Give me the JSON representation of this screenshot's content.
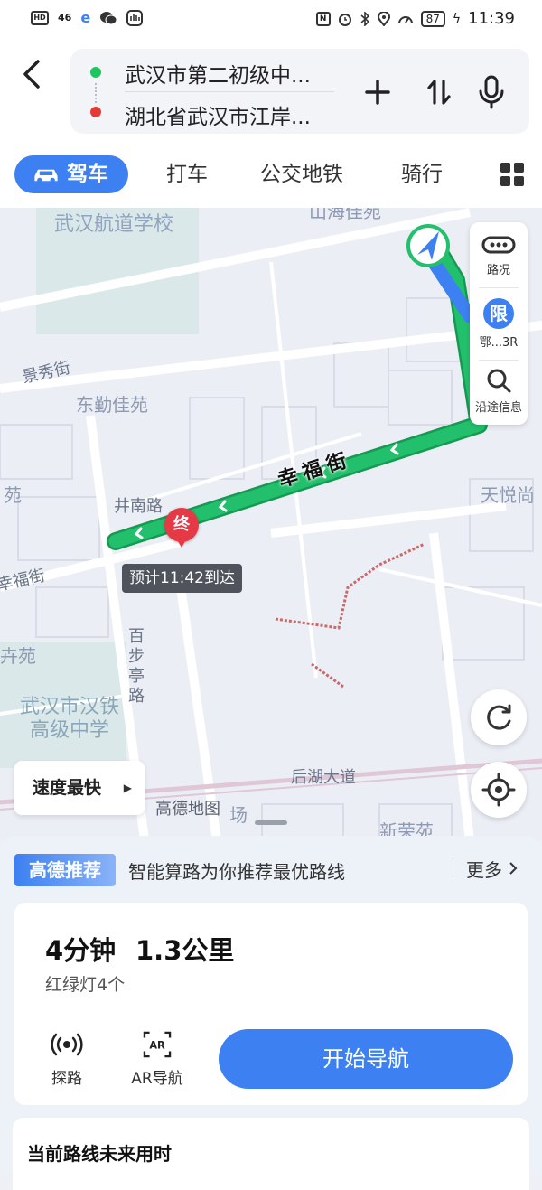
{
  "status_bar": {
    "left_icons": [
      "HD",
      "46",
      "e",
      "wechat-icon",
      "accessibility-icon"
    ],
    "battery": "87",
    "time": "11:39"
  },
  "header": {
    "start": "武汉市第二初级中...",
    "end": "湖北省武汉市江岸...",
    "add_icon": "+",
    "swap_icon": "⇅"
  },
  "tabs": {
    "drive": "驾车",
    "taxi": "打车",
    "transit": "公交地铁",
    "bike": "骑行"
  },
  "map": {
    "labels": {
      "school_top": "武汉航道学校",
      "area_top": "山海佳苑",
      "jingxiu": "景秀街",
      "dongqin": "东勤佳苑",
      "yuan_left": "苑",
      "jingnan": "井南路",
      "xingfu_left": "幸福街",
      "hui_yuan": "卉苑",
      "baibu": "百步亭路",
      "hantie": "武汉市汉铁\n高级中学",
      "tianyue": "天悦尚",
      "houhu": "后湖大道",
      "xinrong": "新荣苑",
      "field": "场"
    },
    "road_name": "幸福街",
    "side_panel": {
      "traffic": "路况",
      "limit_badge": "限",
      "limit_plate": "鄂...3R",
      "along": "沿途信息"
    },
    "end_pin": "终",
    "eta": "预计11:42到达",
    "strategy": "速度最快",
    "watermark": "高德地图"
  },
  "sheet": {
    "recommend_badge": "高德推荐",
    "recommend_text": "智能算路为你推荐最优路线",
    "more": "更多",
    "duration": "4分钟",
    "distance": "1.3公里",
    "lights": "红绿灯4个",
    "explore": "探路",
    "ar_nav": "AR导航",
    "start_nav": "开始导航",
    "future_title": "当前路线未来用时"
  },
  "colors": {
    "accent": "#3d80f2",
    "route": "#1fbf6a",
    "end_pin": "#e53945"
  }
}
